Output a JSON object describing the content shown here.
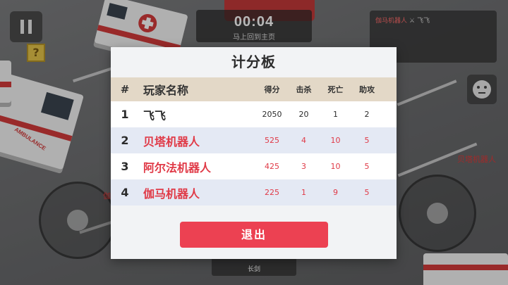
{
  "hud": {
    "timer": "00:04",
    "timer_sub": "马上回到主页",
    "feed_killer": "伽马机器人",
    "feed_victim": "飞飞",
    "weapon_name": "长剑",
    "enemy_tag_right": "贝塔机器人",
    "enemy_tag_left": "伽",
    "ambulance_text": "AMBULANCE",
    "crate_mark": "?"
  },
  "scoreboard": {
    "title": "计分板",
    "headers": {
      "rank": "#",
      "name": "玩家名称",
      "score": "得分",
      "kills": "击杀",
      "deaths": "死亡",
      "assists": "助攻"
    },
    "rows": [
      {
        "rank": "1",
        "name": "飞飞",
        "score": "2050",
        "kills": "20",
        "deaths": "1",
        "assists": "2"
      },
      {
        "rank": "2",
        "name": "贝塔机器人",
        "score": "525",
        "kills": "4",
        "deaths": "10",
        "assists": "5"
      },
      {
        "rank": "3",
        "name": "阿尔法机器人",
        "score": "425",
        "kills": "3",
        "deaths": "10",
        "assists": "5"
      },
      {
        "rank": "4",
        "name": "伽马机器人",
        "score": "225",
        "kills": "1",
        "deaths": "9",
        "assists": "5"
      }
    ],
    "exit_label": "退出"
  },
  "colors": {
    "accent_red": "#ec4152",
    "bot_name": "#e03a47",
    "header_band": "#e3d8c7",
    "alt_row": "#e4e9f4"
  },
  "icons": {
    "pause": "pause-icon",
    "emote": "emote-face-icon",
    "crate": "mystery-crate-icon"
  }
}
